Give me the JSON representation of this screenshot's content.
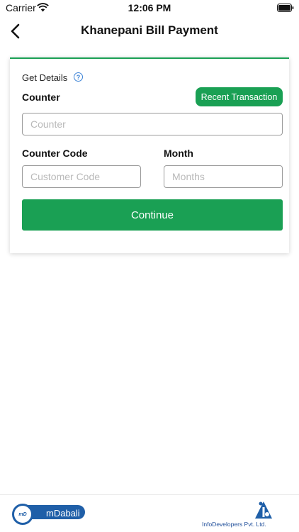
{
  "status_bar": {
    "carrier": "Carrier",
    "time": "12:06 PM"
  },
  "nav": {
    "title": "Khanepani Bill Payment"
  },
  "form": {
    "section_label": "Get Details",
    "counter_label": "Counter",
    "recent_transaction_label": "Recent Transaction",
    "counter_placeholder": "Counter",
    "counter_code_label": "Counter Code",
    "customer_code_placeholder": "Customer Code",
    "month_label": "Month",
    "months_placeholder": "Months",
    "continue_label": "Continue"
  },
  "footer": {
    "app_logo_text": "mDabali",
    "app_logo_mark": "mD",
    "company_text": "InfoDevelopers Pvt. Ltd."
  },
  "colors": {
    "accent": "#1aa054",
    "brand_blue": "#1f5fa8",
    "help_blue": "#3b82d6"
  }
}
